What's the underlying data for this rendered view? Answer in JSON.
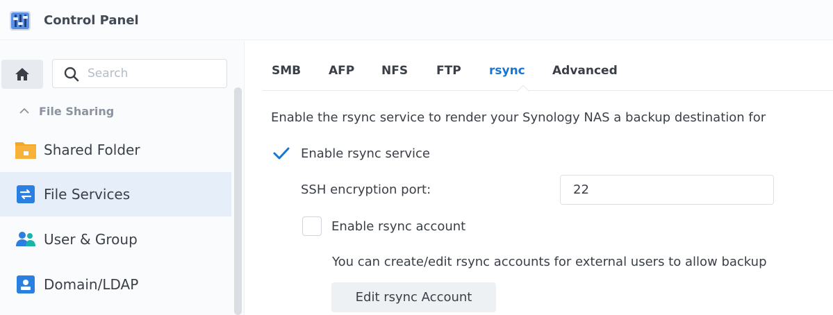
{
  "app": {
    "title": "Control Panel",
    "icon": "control-panel-icon"
  },
  "sidebar": {
    "home_icon": "home-icon",
    "search": {
      "placeholder": "Search",
      "value": ""
    },
    "section": {
      "label": "File Sharing",
      "icon": "chevron-up-icon"
    },
    "items": [
      {
        "label": "Shared Folder",
        "icon": "folder-icon",
        "active": false
      },
      {
        "label": "File Services",
        "icon": "file-services-icon",
        "active": true
      },
      {
        "label": "User & Group",
        "icon": "users-icon",
        "active": false
      },
      {
        "label": "Domain/LDAP",
        "icon": "domain-icon",
        "active": false
      }
    ]
  },
  "main": {
    "tabs": [
      {
        "label": "SMB",
        "active": false
      },
      {
        "label": "AFP",
        "active": false
      },
      {
        "label": "NFS",
        "active": false
      },
      {
        "label": "FTP",
        "active": false
      },
      {
        "label": "rsync",
        "active": true
      },
      {
        "label": "Advanced",
        "active": false
      }
    ],
    "description": "Enable the rsync service to render your Synology NAS a backup destination for",
    "enable_rsync": {
      "label": "Enable rsync service",
      "checked": true
    },
    "ssh_port": {
      "label": "SSH encryption port:",
      "value": "22"
    },
    "enable_account": {
      "label": "Enable rsync account",
      "checked": false
    },
    "account_help": "You can create/edit rsync accounts for external users to allow backup",
    "edit_button": "Edit rsync Account"
  },
  "colors": {
    "accent": "#1677d2",
    "active_bg": "#e6eefa",
    "folder_orange": "#f5a623",
    "icon_blue": "#2a7fe0"
  }
}
